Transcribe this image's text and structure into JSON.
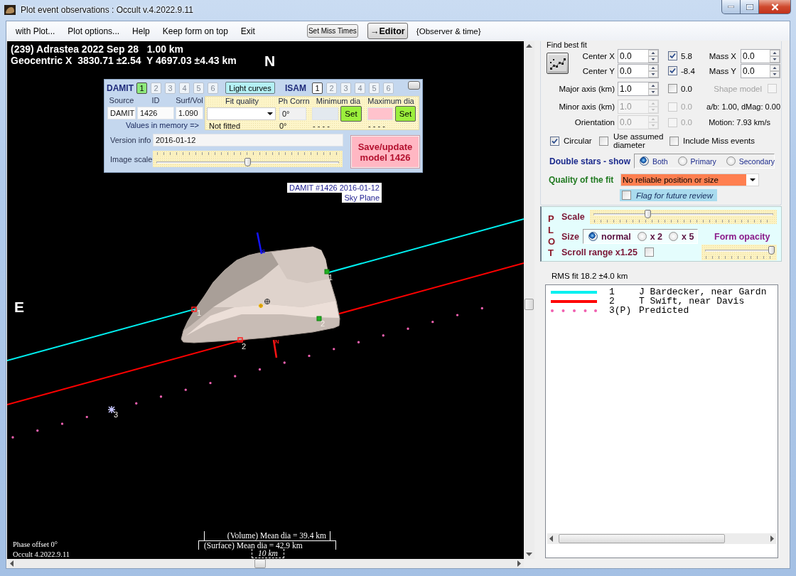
{
  "window": {
    "title": "Plot event observations : Occult v.4.2022.9.11"
  },
  "menu": [
    "with Plot...",
    "Plot options...",
    "Help",
    "Keep form on top",
    "Exit"
  ],
  "toolbar": {
    "buttons": [
      {
        "kind": "small",
        "label": "Set Miss Times"
      },
      {
        "kind": "bold",
        "label": "→Editor"
      }
    ],
    "note": "{Observer & time}"
  },
  "plot": {
    "header": [
      "(239) Adrastea 2022 Sep 28   1.00 km",
      "Geocentric X  3830.71 ±2.54  Y 4697.03 ±4.43 km"
    ],
    "north_label": "N",
    "east_label": "E",
    "model_caption": [
      "DAMIT #1426 2016-01-12",
      "Sky Plane"
    ],
    "pole_axes": [
      {
        "label": "S",
        "color": "#1414ff"
      },
      {
        "label": "N",
        "color": "#ff1414"
      }
    ],
    "chords": [
      {
        "color": "#00f0f0",
        "labels": [
          "1",
          "1"
        ]
      },
      {
        "color": "#ff0000",
        "labels": [
          "2",
          "2"
        ]
      }
    ],
    "predicted": {
      "color": "#f060b0",
      "label": "3"
    },
    "footer": [
      "Phase offset 0°",
      "Occult 4.2022.9.11"
    ],
    "scale_bars": [
      {
        "kind": "volume",
        "label": "(Volume) Mean dia = 39.4 km"
      },
      {
        "kind": "surface",
        "label": "(Surface) Mean dia = 42.9 km"
      },
      {
        "kind": "scale",
        "label": "10 km"
      }
    ]
  },
  "shape_panel": {
    "damit": {
      "label": "DAMIT",
      "models": [
        {
          "label": "1",
          "selected": true,
          "disabled": false
        },
        {
          "label": "2",
          "selected": false,
          "disabled": true
        },
        {
          "label": "3",
          "selected": false,
          "disabled": true
        },
        {
          "label": "4",
          "selected": false,
          "disabled": true
        },
        {
          "label": "5",
          "selected": false,
          "disabled": true
        },
        {
          "label": "6",
          "selected": false,
          "disabled": true
        }
      ]
    },
    "light_curves": "Light curves",
    "isam": {
      "label": "ISAM",
      "models": [
        {
          "label": "1",
          "selected": false,
          "disabled": false
        },
        {
          "label": "2",
          "selected": false,
          "disabled": true
        },
        {
          "label": "3",
          "selected": false,
          "disabled": true
        },
        {
          "label": "4",
          "selected": false,
          "disabled": true
        },
        {
          "label": "5",
          "selected": false,
          "disabled": true
        },
        {
          "label": "6",
          "selected": false,
          "disabled": true
        }
      ]
    },
    "fields": [
      {
        "label": "Source",
        "value": "DAMIT"
      },
      {
        "label": "ID",
        "value": "1426"
      },
      {
        "label": "Surf/Vol",
        "value": "1.090"
      }
    ],
    "memory_label": "Values in memory =>",
    "fit": {
      "headers": [
        "Fit quality",
        "Ph Corrn",
        "Minimum dia",
        "Maximum dia"
      ],
      "ph_corrn": "0°",
      "set_buttons": [
        "Set",
        "Set"
      ],
      "memory": [
        "Not fitted",
        "0°",
        "- - - -",
        "- - - -"
      ]
    },
    "version_info": {
      "label": "Version info",
      "value": "2016-01-12"
    },
    "image_scale": {
      "label": "Image scale",
      "level": 0.5
    },
    "save_button": "Save/update model 1426"
  },
  "fit_panel": {
    "title": "Find best fit",
    "rows": [
      {
        "label": "Center X",
        "value": "0.0",
        "disabled": false,
        "check": {
          "label": "5.8",
          "checked": true,
          "disabled": false
        }
      },
      {
        "label": "Center Y",
        "value": "0.0",
        "disabled": false,
        "check": {
          "label": "-8.4",
          "checked": true,
          "disabled": false
        }
      },
      {
        "label": "Major axis (km)",
        "value": "1.0",
        "disabled": false,
        "check": {
          "label": "0.0",
          "checked": false,
          "disabled": false
        }
      },
      {
        "label": "Minor axis (km)",
        "value": "1.0",
        "disabled": true,
        "check": {
          "label": "0.0",
          "checked": false,
          "disabled": true
        }
      },
      {
        "label": "Orientation",
        "value": "0.0",
        "disabled": true,
        "check": {
          "label": "0.0",
          "checked": false,
          "disabled": true
        }
      }
    ],
    "mass": [
      {
        "label": "Mass X",
        "value": "0.0"
      },
      {
        "label": "Mass Y",
        "value": "0.0"
      }
    ],
    "shape_model": {
      "label": "Shape model",
      "checked": false,
      "disabled": true
    },
    "ratio": "a/b: 1.00, dMag: 0.00",
    "motion": "Motion: 7.93 km/s",
    "options": [
      {
        "label": "Circular",
        "checked": true
      },
      {
        "label": "Use assumed diameter",
        "checked": false
      },
      {
        "label": "Include Miss events",
        "checked": false
      }
    ],
    "double_stars": {
      "label": "Double stars - show",
      "options": [
        {
          "label": "Both",
          "selected": true
        },
        {
          "label": "Primary",
          "selected": false
        },
        {
          "label": "Secondary",
          "selected": false
        }
      ]
    },
    "quality": {
      "label": "Quality of the fit",
      "value": "No reliable position or size"
    },
    "flag": {
      "label": "Flag for future review",
      "checked": false
    }
  },
  "plot_options": {
    "title": "PLOT",
    "scale": {
      "label": "Scale",
      "level": 0.3
    },
    "size": {
      "label": "Size",
      "options": [
        {
          "label": "normal",
          "selected": true
        },
        {
          "label": "x 2",
          "selected": false
        },
        {
          "label": "x 5",
          "selected": false
        }
      ]
    },
    "opacity": {
      "label": "Form opacity",
      "level": 0.98
    },
    "scroll_range": {
      "label": "Scroll range x1.25",
      "checked": false
    }
  },
  "rms": "RMS fit 18.2 ±4.0 km",
  "legend": [
    {
      "kind": "line",
      "color": "#00f0f0",
      "number": "1",
      "name": "J Bardecker, near Gardn"
    },
    {
      "kind": "line",
      "color": "#ff0000",
      "number": "2",
      "name": "T Swift, near Davis"
    },
    {
      "kind": "dots",
      "color": "#f060b0",
      "number": "3(P)",
      "name": "Predicted"
    }
  ]
}
